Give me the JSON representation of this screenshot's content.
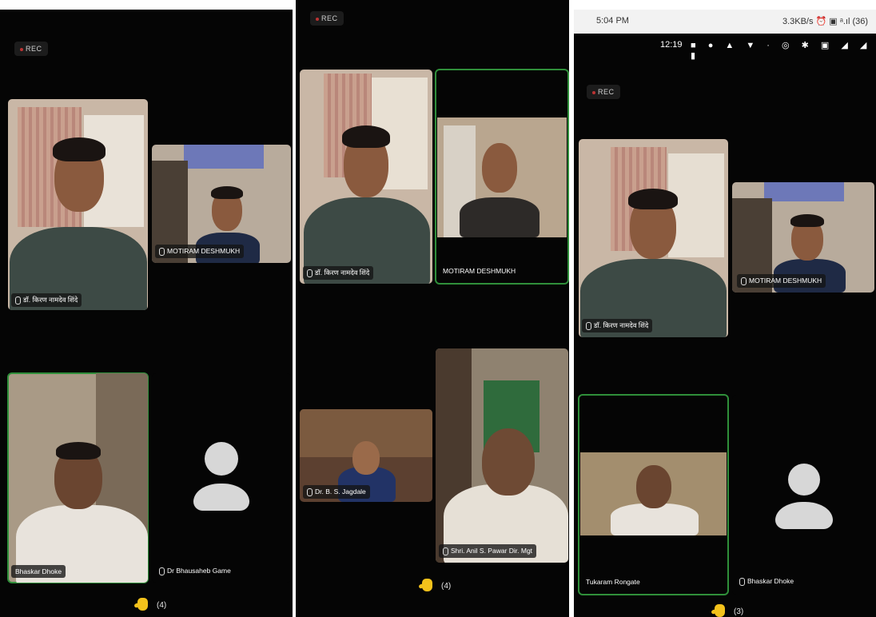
{
  "panel1": {
    "rec": "REC",
    "tiles": [
      {
        "name": "डॉ. किरण नामदेव शिंदे"
      },
      {
        "name": "MOTIRAM DESHMUKH"
      },
      {
        "name": "Bhaskar Dhoke"
      },
      {
        "name": "Dr Bhausaheb Game"
      }
    ],
    "raised_count": "(4)"
  },
  "panel2": {
    "rec": "REC",
    "tiles": [
      {
        "name": "डॉ. किरण नामदेव शिंदे"
      },
      {
        "name": "MOTIRAM DESHMUKH"
      },
      {
        "name": "Dr. B. S. Jagdale"
      },
      {
        "name": "Shri. Anil S. Pawar Dir. Mgt"
      }
    ],
    "raised_count": "(4)"
  },
  "panel3": {
    "status_time": "5:04 PM",
    "status_right": "3.3KB/s ⏰ ▣ ᵃ.ıl (36)",
    "system_time": "12:19",
    "rec": "REC",
    "tiles": [
      {
        "name": "डॉ. किरण नामदेव शिंदे"
      },
      {
        "name": "MOTIRAM DESHMUKH"
      },
      {
        "name": "Tukaram Rongate"
      },
      {
        "name": "Bhaskar Dhoke"
      }
    ],
    "raised_count": "(3)"
  },
  "colors": {
    "active_border": "#2f8f3a",
    "raised_hand": "#f4c21b",
    "panel_bg": "#050505"
  }
}
